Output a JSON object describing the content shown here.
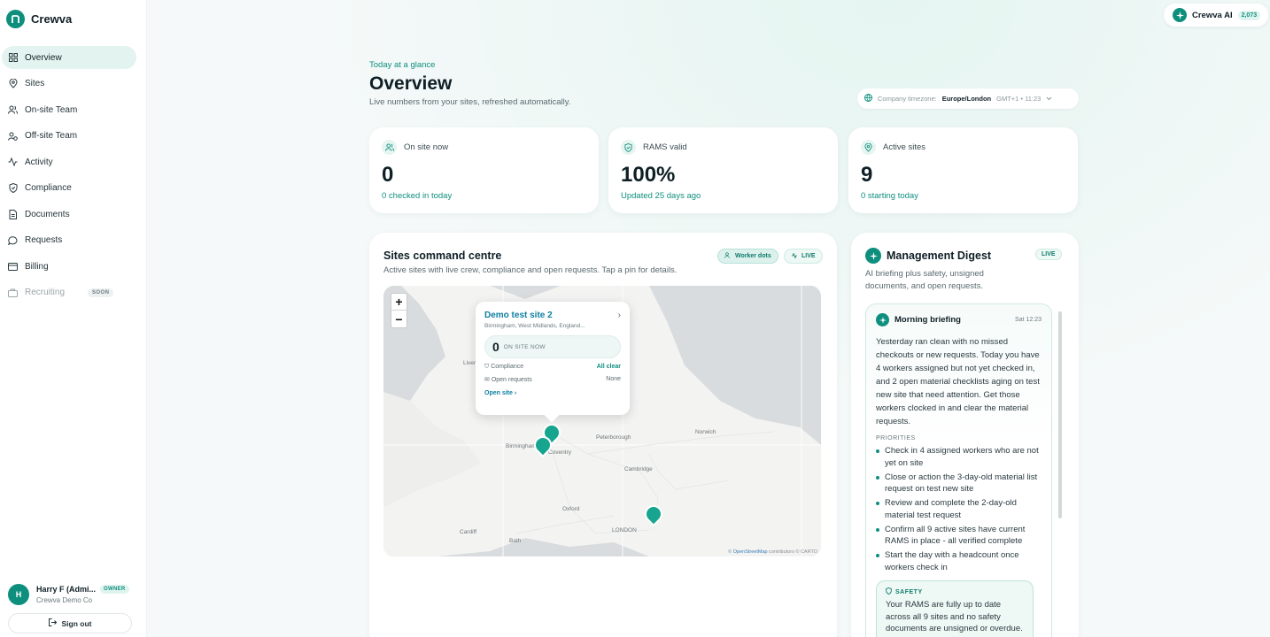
{
  "app": {
    "name": "Crewva"
  },
  "sidebar": {
    "items": [
      {
        "label": "Overview",
        "icon": "grid-icon"
      },
      {
        "label": "Sites",
        "icon": "map-pin-icon"
      },
      {
        "label": "On-site Team",
        "icon": "users-icon"
      },
      {
        "label": "Off-site Team",
        "icon": "user-remote-icon"
      },
      {
        "label": "Activity",
        "icon": "activity-icon"
      },
      {
        "label": "Compliance",
        "icon": "shield-icon"
      },
      {
        "label": "Documents",
        "icon": "document-icon"
      },
      {
        "label": "Requests",
        "icon": "chat-icon"
      },
      {
        "label": "Billing",
        "icon": "card-icon"
      },
      {
        "label": "Recruiting",
        "icon": "briefcase-icon",
        "badge": "SOON"
      }
    ],
    "user": {
      "initial": "H",
      "name": "Harry F (Admi...",
      "role": "OWNER",
      "org": "Crewva Demo Co"
    },
    "signout": "Sign out"
  },
  "ai": {
    "label": "Crewva AI",
    "count": "2,073"
  },
  "header": {
    "eyebrow": "Today at a glance",
    "title": "Overview",
    "subtitle": "Live numbers from your sites, refreshed automatically.",
    "timezone": {
      "label": "Company timezone:",
      "value": "Europe/London",
      "offset": "GMT+1 • 11:23"
    }
  },
  "stats": [
    {
      "label": "On site now",
      "value": "0",
      "note": "0 checked in today"
    },
    {
      "label": "RAMS valid",
      "value": "100%",
      "note": "Updated 25 days ago"
    },
    {
      "label": "Active sites",
      "value": "9",
      "note": "0 starting today"
    }
  ],
  "sites": {
    "title": "Sites command centre",
    "subtitle": "Active sites with live crew, compliance and open requests. Tap a pin for details.",
    "worker_dots": "Worker dots",
    "live": "LIVE",
    "map_labels": [
      "Liverpool",
      "Peterborough",
      "Norwich",
      "Cambridge",
      "Oxford",
      "LONDON",
      "Cardiff",
      "Bath",
      "Coventry",
      "Birmingham"
    ],
    "attribution": {
      "prefix": "©",
      "link": "OpenStreetMap",
      "suffix": "contributors © CARTO"
    },
    "popup": {
      "title": "Demo test site 2",
      "address": "Birmingham, West Midlands, England...",
      "onsite_num": "0",
      "onsite_label": "ON SITE NOW",
      "compliance_label": "Compliance",
      "compliance_value": "All clear",
      "requests_label": "Open requests",
      "requests_value": "None",
      "link": "Open site"
    }
  },
  "digest": {
    "title": "Management Digest",
    "live": "LIVE",
    "subtitle": "AI briefing plus safety, unsigned documents, and open requests.",
    "briefing": {
      "title": "Morning briefing",
      "time": "Sat 12:23",
      "text": "Yesterday ran clean with no missed checkouts or new requests. Today you have 4 workers assigned but not yet checked in, and 2 open material checklists aging on test new site that need attention. Get those workers clocked in and clear the material requests.",
      "priorities_label": "PRIORITIES",
      "priorities": [
        "Check in 4 assigned workers who are not yet on site",
        "Close or action the 3-day-old material list request on test new site",
        "Review and complete the 2-day-old material test request",
        "Confirm all 9 active sites have current RAMS in place - all verified complete",
        "Start the day with a headcount once workers check in"
      ],
      "safety_label": "SAFETY",
      "safety_text": "Your RAMS are fully up to date across all 9 sites and no safety documents are unsigned or overdue. No expired"
    }
  }
}
